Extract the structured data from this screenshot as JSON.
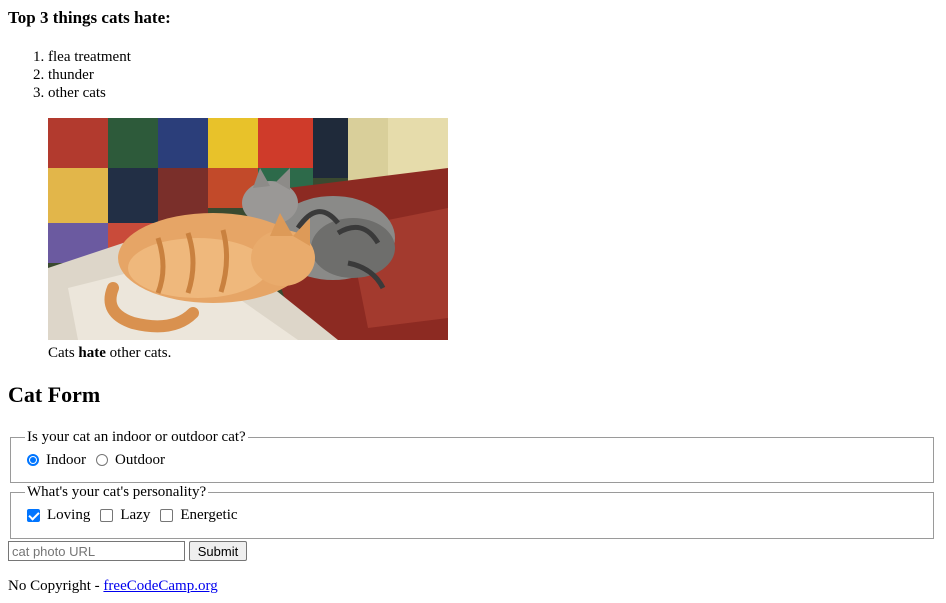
{
  "list_title": "Top 3 things cats hate:",
  "hate_list": [
    "flea treatment",
    "thunder",
    "other cats"
  ],
  "figure": {
    "caption_before": "Cats ",
    "caption_bold": "hate",
    "caption_after": " other cats."
  },
  "form_title": "Cat Form",
  "indoor_outdoor": {
    "legend": "Is your cat an indoor or outdoor cat?",
    "options": [
      {
        "label": "Indoor",
        "checked": true
      },
      {
        "label": "Outdoor",
        "checked": false
      }
    ]
  },
  "personality": {
    "legend": "What's your cat's personality?",
    "options": [
      {
        "label": "Loving",
        "checked": true
      },
      {
        "label": "Lazy",
        "checked": false
      },
      {
        "label": "Energetic",
        "checked": false
      }
    ]
  },
  "url_input": {
    "placeholder": "cat photo URL",
    "value": ""
  },
  "submit_label": "Submit",
  "footer": {
    "text": "No Copyright - ",
    "link_text": "freeCodeCamp.org"
  },
  "colors": {
    "accent": "#0075ff",
    "link": "#0000ee"
  }
}
